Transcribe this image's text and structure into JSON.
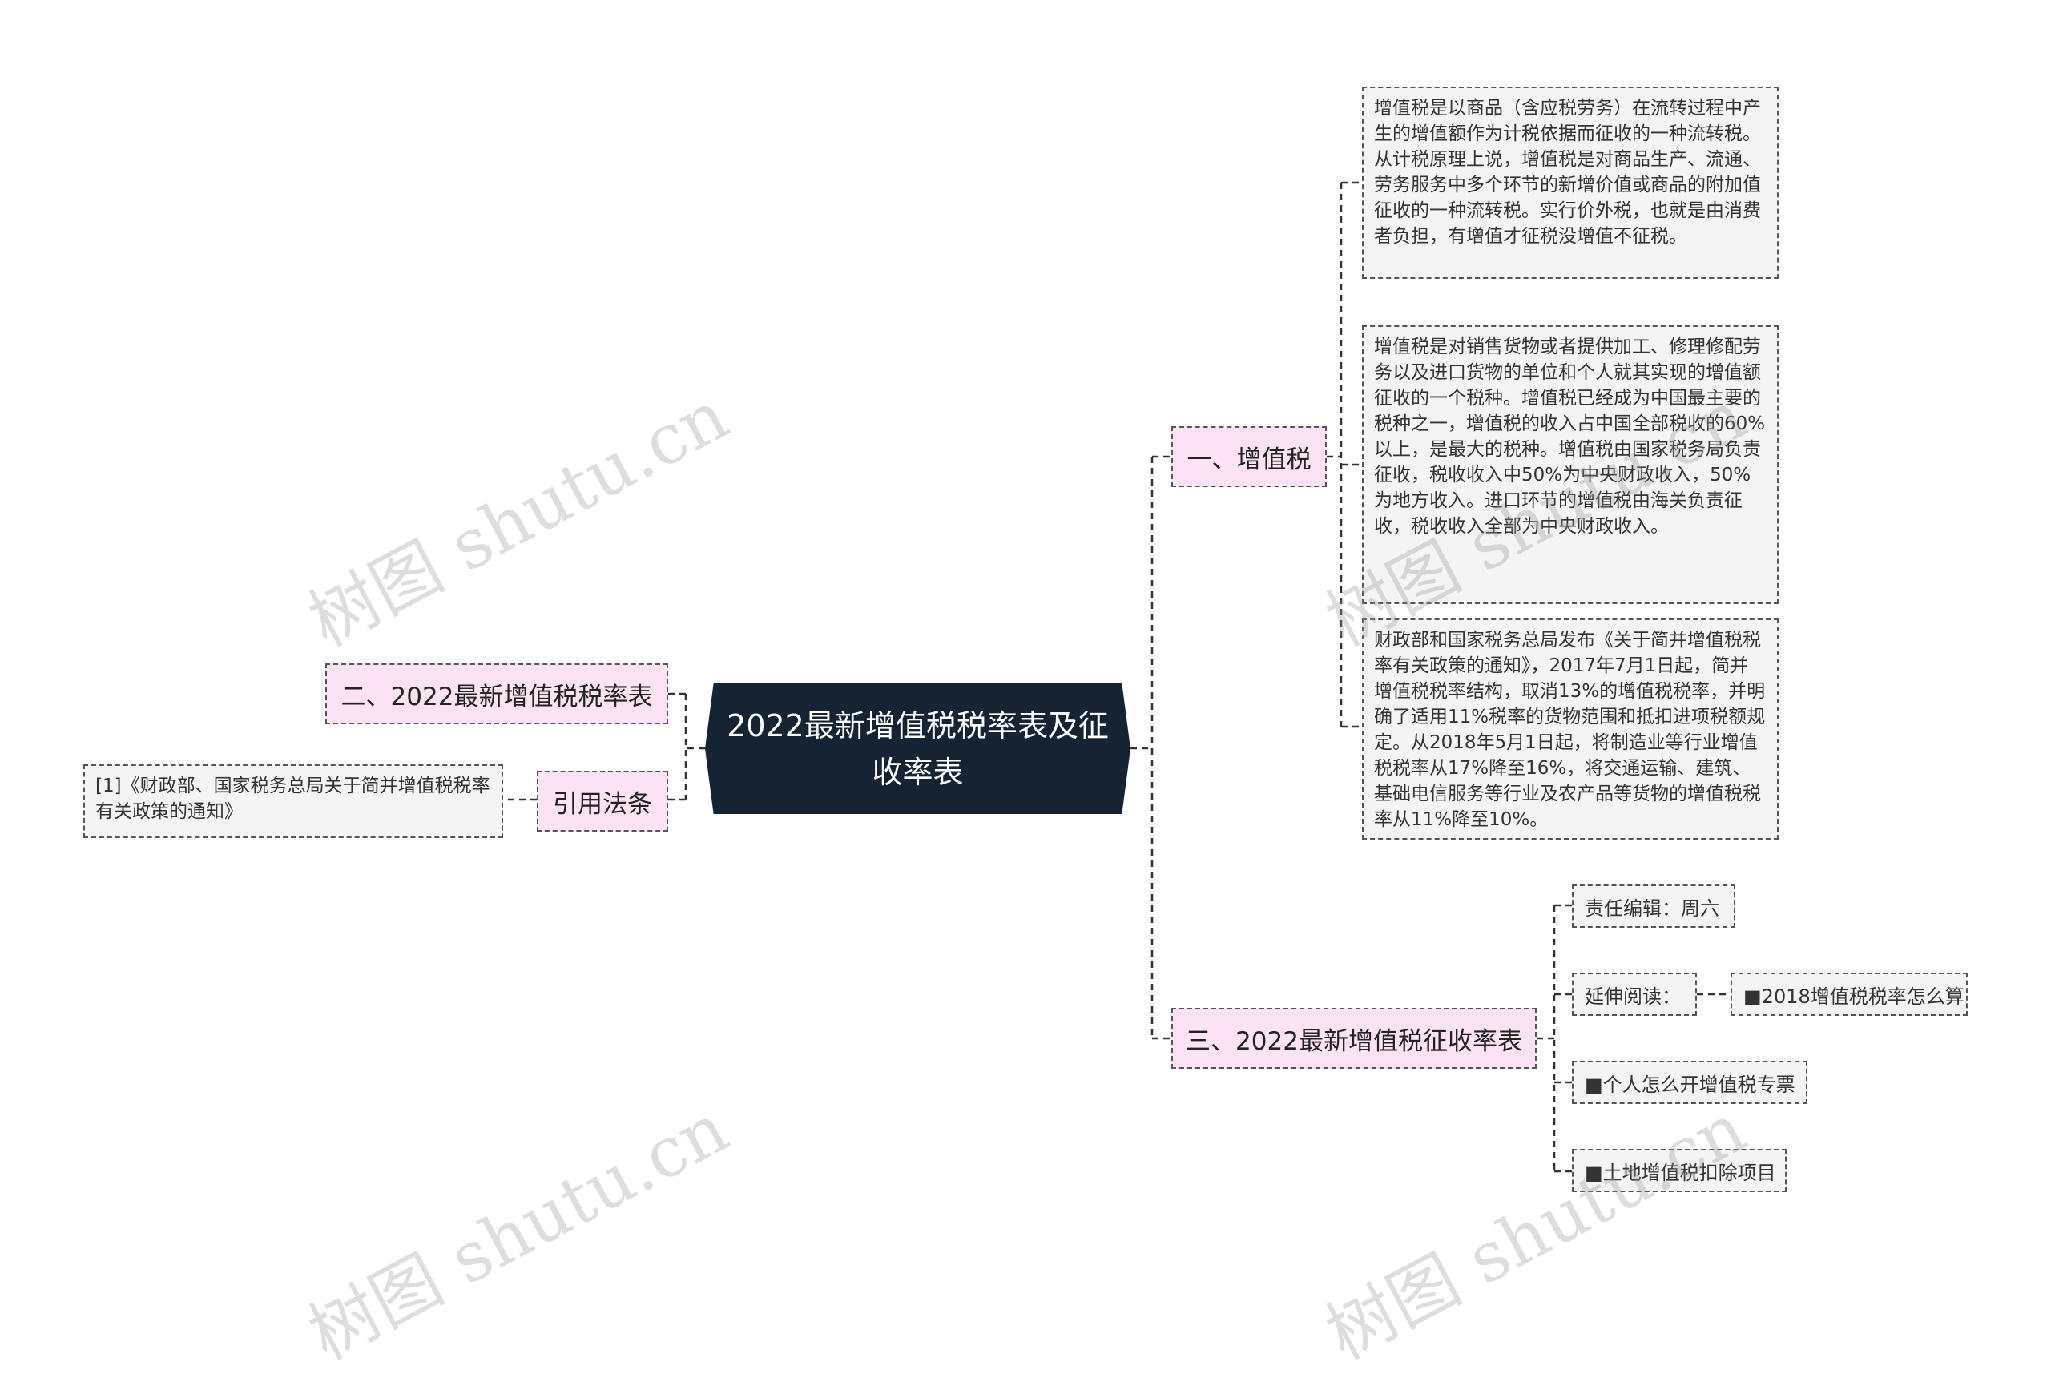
{
  "watermark": "树图 shutu.cn",
  "center": {
    "title": "2022最新增值税税率表及征收率表"
  },
  "branch1": {
    "label": "一、增值税",
    "paragraphs": [
      "增值税是以商品（含应税劳务）在流转过程中产生的增值额作为计税依据而征收的一种流转税。从计税原理上说，增值税是对商品生产、流通、劳务服务中多个环节的新增价值或商品的附加值征收的一种流转税。实行价外税，也就是由消费者负担，有增值才征税没增值不征税。",
      "增值税是对销售货物或者提供加工、修理修配劳务以及进口货物的单位和个人就其实现的增值额征收的一个税种。增值税已经成为中国最主要的税种之一，增值税的收入占中国全部税收的60%以上，是最大的税种。增值税由国家税务局负责征收，税收收入中50%为中央财政收入，50%为地方收入。进口环节的增值税由海关负责征收，税收收入全部为中央财政收入。",
      "财政部和国家税务总局发布《关于简并增值税税率有关政策的通知》，2017年7月1日起，简并增值税税率结构，取消13%的增值税税率，并明确了适用11%税率的货物范围和抵扣进项税额规定。从2018年5月1日起，将制造业等行业增值税税率从17%降至16%，将交通运输、建筑、基础电信服务等行业及农产品等货物的增值税税率从11%降至10%。"
    ]
  },
  "branch2": {
    "label": "二、2022最新增值税税率表"
  },
  "branch3": {
    "label": "三、2022最新增值税征收率表",
    "editor": "责任编辑：周六",
    "extended_label": "延伸阅读：",
    "links": [
      "■2018增值税税率怎么算",
      "■个人怎么开增值税专票",
      "■土地增值税扣除项目"
    ]
  },
  "citation": {
    "label": "引用法条",
    "text": "[1]《财政部、国家税务总局关于简并增值税税率有关政策的通知》"
  }
}
